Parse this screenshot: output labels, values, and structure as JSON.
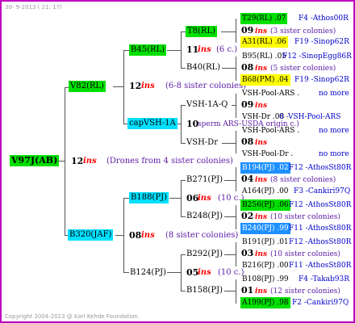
{
  "header": "30-  9-2013 ( 21: 17)",
  "footer": "Copyright 2004-2013 @ Karl Kehde Foundation.",
  "root": {
    "name": "V97J(AB)",
    "year": "12",
    "ins": "ins",
    "note": "(Drones from 4 sister colonies)"
  },
  "gen1": {
    "father": {
      "name": "V82(RL)",
      "year": "12",
      "ins": "ins",
      "note": "(6-8 sister colonies)"
    },
    "mother": {
      "name": "B320(JAF)",
      "year": "08",
      "ins": "ins",
      "note": "(8 sister colonies)"
    }
  },
  "gen2": {
    "a": {
      "name": "B45(RL)",
      "year": "11",
      "ins": "ins",
      "note": "(6 c.)"
    },
    "b": {
      "name": "capVSH-1A",
      "year": "10",
      "note": "sperm ARS-USDA origin c.)"
    },
    "c": {
      "name": "B188(PJ)",
      "year": "06",
      "ins": "ins",
      "note": "(10 c.)"
    },
    "d": {
      "name": "B124(PJ)",
      "year": "05",
      "ins": "ins",
      "note": "(10 c.)"
    }
  },
  "gen3": {
    "a": {
      "name": "T8(RL)"
    },
    "b": {
      "name": "B40(RL)"
    },
    "c": {
      "name": "VSH-1A-Q"
    },
    "d": {
      "name": "VSH-Dr"
    },
    "e": {
      "name": "B271(PJ)"
    },
    "f": {
      "name": "B248(PJ)"
    },
    "g": {
      "name": "B292(PJ)"
    },
    "h": {
      "name": "B158(PJ)"
    }
  },
  "gen4": [
    {
      "top": "T29(RL) .07",
      "top_ref": "F4 -Athos00R",
      "mid_year": "09",
      "mid_ins": "ins",
      "mid_note": "(3 sister colonies)",
      "bot": "A31(RL) .06",
      "bot_ref": "F19 -Sinop62R"
    },
    {
      "top": "B95(RL) .05",
      "top_ref": "F12 -SinopEgg86R",
      "mid_year": "08",
      "mid_ins": "ins",
      "mid_note": "(5 sister colonies)",
      "bot": "B68(PM) .04",
      "bot_ref": "F19 -Sinop62R"
    },
    {
      "top": "VSH-Pool-ARS .",
      "top_ref": "no more",
      "mid_year": "09",
      "mid_ins": "ins",
      "mid_note": "",
      "bot": "VSH-Dr .08",
      "bot_ref": "0 -VSH-Pool-ARS"
    },
    {
      "top": "VSH-Pool-ARS .",
      "top_ref": "no more",
      "mid_year": "08",
      "mid_ins": "ins",
      "mid_note": "",
      "bot": "VSH-Pool-Dr .",
      "bot_ref": "no more"
    },
    {
      "top": "B194(PJ) .02",
      "top_ref": "F12 -AthosSt80R",
      "mid_year": "04",
      "mid_ins": "ins",
      "mid_note": "(8 sister colonies)",
      "bot": "A164(PJ) .00",
      "bot_ref": "F3 -Cankiri97Q"
    },
    {
      "top": "B256(PJ) .06",
      "top_ref": "F12 -AthosSt80R",
      "mid_year": "02",
      "mid_ins": "ins",
      "mid_note": "(10 sister colonies)",
      "bot": "B240(PJ) .99",
      "bot_ref": "F11 -AthosSt80R"
    },
    {
      "top": "B191(PJ) .01",
      "top_ref": "F12 -AthosSt80R",
      "mid_year": "03",
      "mid_ins": "ins",
      "mid_note": "(10 sister colonies)",
      "bot": "B216(PJ) .00",
      "bot_ref": "F11 -AthosSt80R"
    },
    {
      "top": "B108(PJ) .99",
      "top_ref": "F4 -Takab93R",
      "mid_year": "01",
      "mid_ins": "ins",
      "mid_note": "(12 sister colonies)",
      "bot": "A199(PJ) .98",
      "bot_ref": "F2 -Cankiri97Q"
    }
  ]
}
